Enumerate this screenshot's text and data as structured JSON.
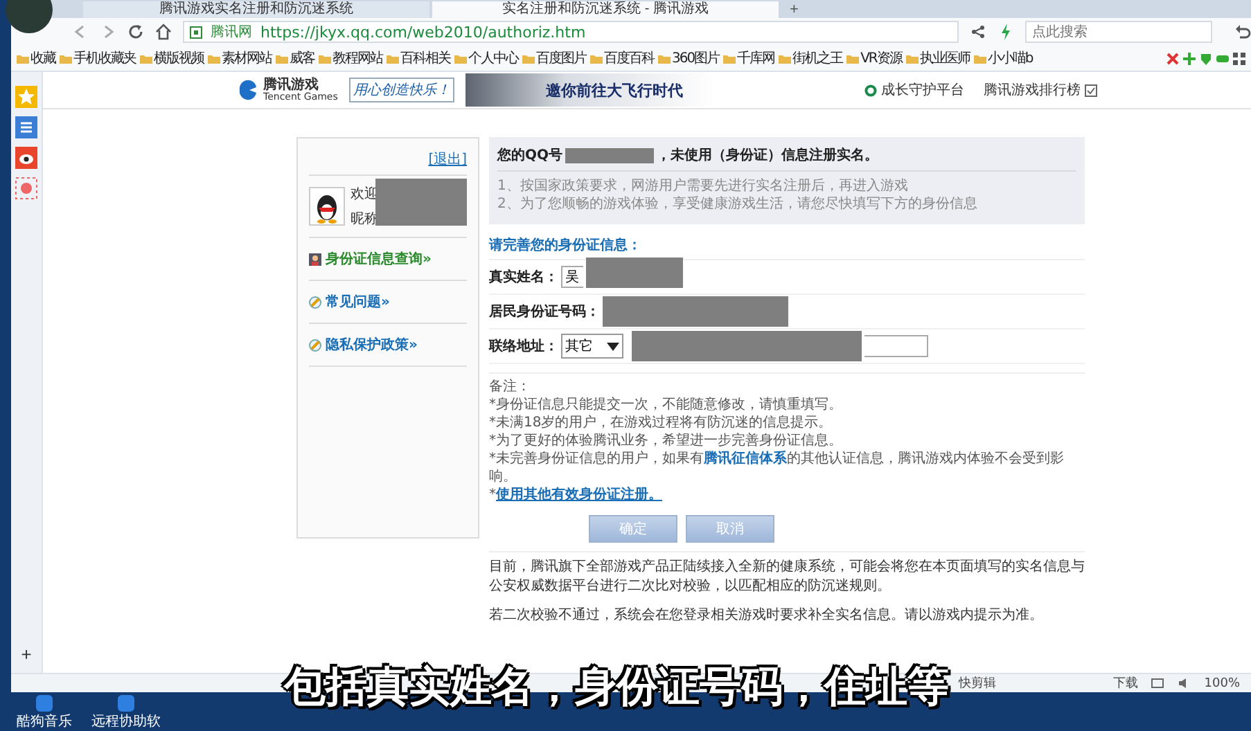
{
  "browser": {
    "tabs": [
      {
        "title": "腾讯游戏实名注册和防沉迷系统",
        "selected": false
      },
      {
        "title": "实名注册和防沉迷系统 - 腾讯游戏",
        "selected": true
      }
    ],
    "new_tab": "+",
    "address": {
      "site_label": "腾讯网",
      "url": "https://jkyx.qq.com/web2010/authoriz.htm"
    },
    "search": {
      "placeholder": "点此搜索"
    },
    "bookmarks": [
      "收藏",
      "手机收藏夹",
      "横版视频",
      "素材网站",
      "威客",
      "教程网站",
      "百科相关",
      "个人中心",
      "百度图片",
      "百度百科",
      "360图片",
      "千库网",
      "街机之王",
      "VR资源",
      "执业医师",
      "小小喵b"
    ],
    "sidebar_add": "+"
  },
  "site_header": {
    "logo_text": "腾讯游戏",
    "logo_sub": "Tencent Games",
    "slogan": "用心创造快乐！",
    "banner_title": "邀你前往大飞行时代",
    "links": [
      "成长守护平台",
      "腾讯游戏排行榜"
    ]
  },
  "left_panel": {
    "logout": "[退出]",
    "welcome": "欢迎",
    "nickname": "昵称",
    "redacted": true,
    "links": [
      {
        "label": "身份证信息查询»",
        "kind": "id"
      },
      {
        "label": "常见问题»",
        "kind": "faq"
      },
      {
        "label": "隐私保护政策»",
        "kind": "faq"
      }
    ]
  },
  "notice": {
    "title_prefix": "您的QQ号",
    "title_suffix": "，未使用（身份证）信息注册实名。",
    "redacted": true,
    "lines": [
      "1、按国家政策要求，网游用户需要先进行实名注册后，再进入游戏",
      "2、为了您顺畅的游戏体验，享受健康游戏生活，请您尽快填写下方的身份信息"
    ]
  },
  "form": {
    "heading": "请完善您的身份证信息：",
    "fields": [
      {
        "label": "真实姓名：",
        "kind": "text",
        "value": "吴",
        "redacted": true
      },
      {
        "label": "居民身份证号码：",
        "kind": "text",
        "redacted": true
      },
      {
        "label": "联络地址：",
        "kind": "address",
        "select": "其它",
        "redacted": true
      }
    ]
  },
  "notes": {
    "title": "备注：",
    "lines": [
      {
        "text": "*身份证信息只能提交一次，不能随意修改，请慎重填写。"
      },
      {
        "text": "*未满18岁的用户，在游戏过程将有防沉迷的信息提示。"
      },
      {
        "text": "*为了更好的体验腾讯业务，希望进一步完善身份证信息。"
      },
      {
        "text": "*未完善身份证信息的用户，如果有",
        "link": "腾讯征信体系",
        "after": "的其他认证信息，腾讯游戏内体验不会受到影响。"
      },
      {
        "text": "*",
        "link": "使用其他有效身份证注册。"
      }
    ]
  },
  "buttons": [
    "确定",
    "取消"
  ],
  "footer": [
    "目前，腾讯旗下全部游戏产品正陆续接入全新的健康系统，可能会将您在本页面填写的实名信息与公安权威数据平台进行二次比对校验，以匹配相应的防沉迷规则。",
    "若二次校验不通过，系统会在您登录相关游戏时要求补全实名信息。请以游戏内提示为准。"
  ],
  "status_bar": {
    "left": "快剪辑",
    "download": "下载",
    "zoom": "100%"
  },
  "desktop_icons": [
    "酷狗音乐",
    "远程协助软"
  ],
  "subtitle": "包括真实姓名，身份证号码，住址等"
}
